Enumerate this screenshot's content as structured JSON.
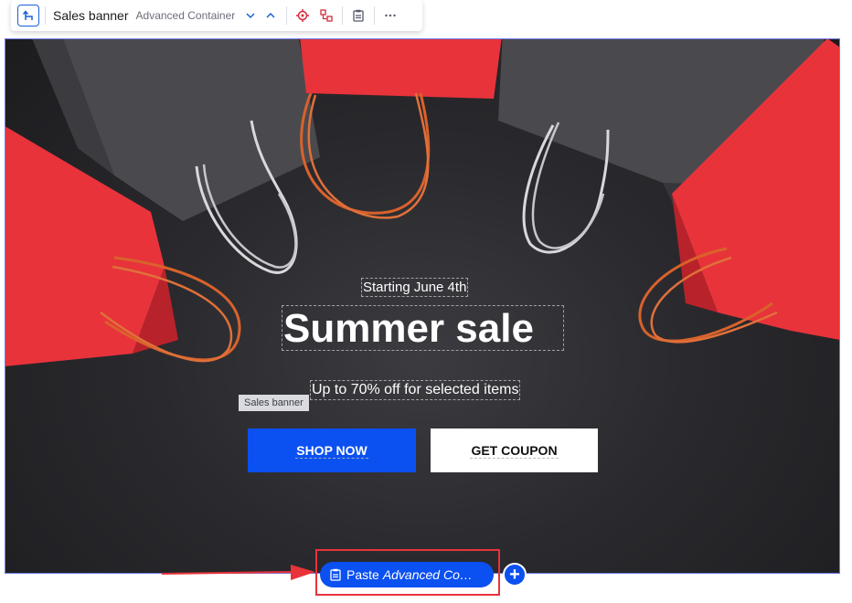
{
  "toolbar": {
    "title": "Sales banner",
    "element_type": "Advanced Container",
    "icons": [
      "select-parent-icon",
      "chevron-down-icon",
      "chevron-up-icon",
      "target-icon",
      "structure-icon",
      "paste-icon",
      "more-icon"
    ]
  },
  "banner": {
    "eyebrow": "Starting June 4th",
    "headline": "Summer sale",
    "subline": "Up to 70% off for selected items",
    "label_tag": "Sales banner",
    "primary_button": "SHOP NOW",
    "secondary_button": "GET COUPON"
  },
  "paste_bar": {
    "label": "Paste",
    "target": "Advanced Co…",
    "add_symbol": "+"
  },
  "colors": {
    "accent": "#0b50f0",
    "annotation": "#e8333b",
    "bag_red": "#e8333b",
    "bag_dark": "#4a4a4e",
    "background_dark": "#2a2a2e"
  }
}
